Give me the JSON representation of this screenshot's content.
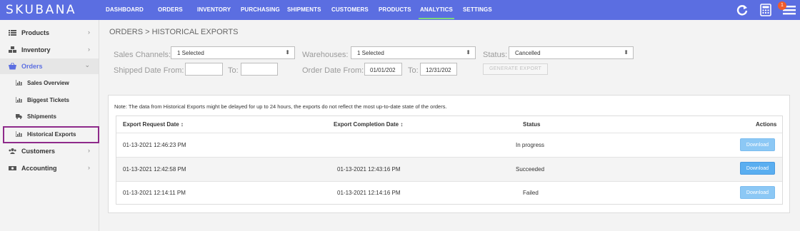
{
  "app": {
    "logo": "SKUBANA"
  },
  "nav": {
    "items": [
      "DASHBOARD",
      "ORDERS",
      "INVENTORY",
      "PURCHASING",
      "SHIPMENTS",
      "CUSTOMERS",
      "PRODUCTS",
      "ANALYTICS",
      "SETTINGS"
    ],
    "active": "ANALYTICS",
    "notification_count": "1",
    "icons": [
      "refresh-icon",
      "calculator-icon",
      "menu-icon"
    ]
  },
  "sidebar": {
    "items": [
      {
        "label": "Products",
        "icon": "list-icon"
      },
      {
        "label": "Inventory",
        "icon": "cubes-icon"
      },
      {
        "label": "Orders",
        "icon": "basket-icon"
      },
      {
        "label": "Sales Overview",
        "icon": "chart-icon"
      },
      {
        "label": "Biggest Tickets",
        "icon": "chart-icon"
      },
      {
        "label": "Shipments",
        "icon": "truck-icon"
      },
      {
        "label": "Historical Exports",
        "icon": "chart-icon"
      },
      {
        "label": "Customers",
        "icon": "users-icon"
      },
      {
        "label": "Accounting",
        "icon": "money-icon"
      }
    ]
  },
  "page": {
    "title": "ORDERS > HISTORICAL EXPORTS"
  },
  "filters": {
    "sales_channels_label": "Sales Channels:",
    "sales_channels_value": "1 Selected",
    "warehouses_label": "Warehouses:",
    "warehouses_value": "1 Selected",
    "status_label": "Status:",
    "status_value": "Cancelled",
    "shipped_from_label": "Shipped Date From:",
    "shipped_from_value": "",
    "shipped_to_label": "To:",
    "shipped_to_value": "",
    "order_from_label": "Order Date From:",
    "order_from_value": "01/01/202",
    "order_to_label": "To:",
    "order_to_value": "12/31/202",
    "generate_label": "GENERATE EXPORT"
  },
  "note": "Note: The data from Historical Exports might be delayed for up to 24 hours, the exports do not reflect the most up-to-date state of the orders.",
  "table": {
    "headers": {
      "request": "Export Request Date",
      "completion": "Export Completion Date",
      "status": "Status",
      "actions": "Actions",
      "sort_glyph": "↕"
    },
    "rows": [
      {
        "request": "01-13-2021 12:46:23 PM",
        "completion": "",
        "status": "In progress",
        "action": "Download"
      },
      {
        "request": "01-13-2021 12:42:58 PM",
        "completion": "01-13-2021 12:43:16 PM",
        "status": "Succeeded",
        "action": "Download"
      },
      {
        "request": "01-13-2021 12:14:11 PM",
        "completion": "01-13-2021 12:14:16 PM",
        "status": "Failed",
        "action": "Download"
      }
    ]
  },
  "colors": {
    "nav_bg": "#5b6ee1",
    "active_underline": "#7dd87a",
    "download_btn": "#5aaef0",
    "highlight": "#8e2a8a",
    "badge": "#ef5b2c"
  }
}
